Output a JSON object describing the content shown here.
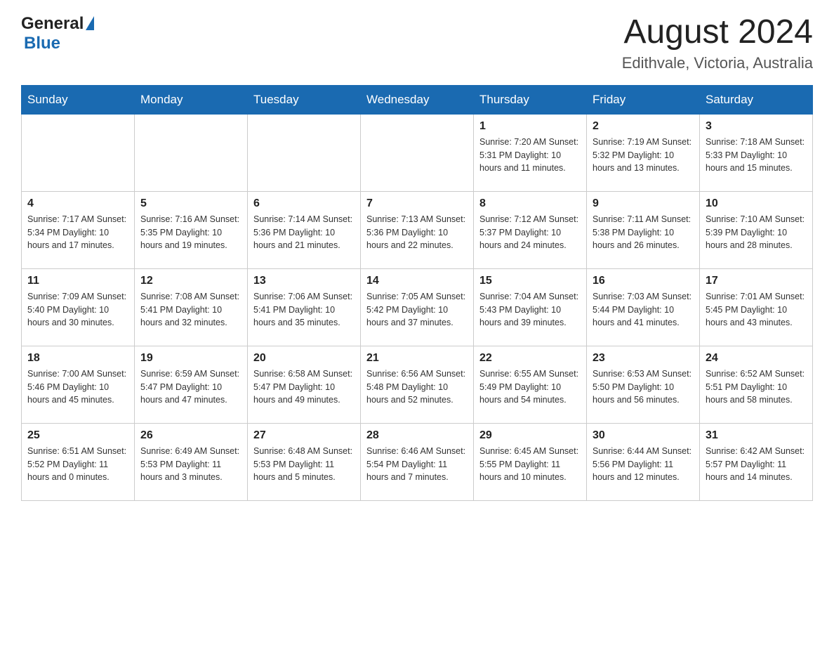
{
  "header": {
    "title": "August 2024",
    "subtitle": "Edithvale, Victoria, Australia"
  },
  "logo": {
    "text1": "General",
    "text2": "Blue"
  },
  "days_of_week": [
    "Sunday",
    "Monday",
    "Tuesday",
    "Wednesday",
    "Thursday",
    "Friday",
    "Saturday"
  ],
  "weeks": [
    [
      {
        "day": "",
        "info": ""
      },
      {
        "day": "",
        "info": ""
      },
      {
        "day": "",
        "info": ""
      },
      {
        "day": "",
        "info": ""
      },
      {
        "day": "1",
        "info": "Sunrise: 7:20 AM\nSunset: 5:31 PM\nDaylight: 10 hours\nand 11 minutes."
      },
      {
        "day": "2",
        "info": "Sunrise: 7:19 AM\nSunset: 5:32 PM\nDaylight: 10 hours\nand 13 minutes."
      },
      {
        "day": "3",
        "info": "Sunrise: 7:18 AM\nSunset: 5:33 PM\nDaylight: 10 hours\nand 15 minutes."
      }
    ],
    [
      {
        "day": "4",
        "info": "Sunrise: 7:17 AM\nSunset: 5:34 PM\nDaylight: 10 hours\nand 17 minutes."
      },
      {
        "day": "5",
        "info": "Sunrise: 7:16 AM\nSunset: 5:35 PM\nDaylight: 10 hours\nand 19 minutes."
      },
      {
        "day": "6",
        "info": "Sunrise: 7:14 AM\nSunset: 5:36 PM\nDaylight: 10 hours\nand 21 minutes."
      },
      {
        "day": "7",
        "info": "Sunrise: 7:13 AM\nSunset: 5:36 PM\nDaylight: 10 hours\nand 22 minutes."
      },
      {
        "day": "8",
        "info": "Sunrise: 7:12 AM\nSunset: 5:37 PM\nDaylight: 10 hours\nand 24 minutes."
      },
      {
        "day": "9",
        "info": "Sunrise: 7:11 AM\nSunset: 5:38 PM\nDaylight: 10 hours\nand 26 minutes."
      },
      {
        "day": "10",
        "info": "Sunrise: 7:10 AM\nSunset: 5:39 PM\nDaylight: 10 hours\nand 28 minutes."
      }
    ],
    [
      {
        "day": "11",
        "info": "Sunrise: 7:09 AM\nSunset: 5:40 PM\nDaylight: 10 hours\nand 30 minutes."
      },
      {
        "day": "12",
        "info": "Sunrise: 7:08 AM\nSunset: 5:41 PM\nDaylight: 10 hours\nand 32 minutes."
      },
      {
        "day": "13",
        "info": "Sunrise: 7:06 AM\nSunset: 5:41 PM\nDaylight: 10 hours\nand 35 minutes."
      },
      {
        "day": "14",
        "info": "Sunrise: 7:05 AM\nSunset: 5:42 PM\nDaylight: 10 hours\nand 37 minutes."
      },
      {
        "day": "15",
        "info": "Sunrise: 7:04 AM\nSunset: 5:43 PM\nDaylight: 10 hours\nand 39 minutes."
      },
      {
        "day": "16",
        "info": "Sunrise: 7:03 AM\nSunset: 5:44 PM\nDaylight: 10 hours\nand 41 minutes."
      },
      {
        "day": "17",
        "info": "Sunrise: 7:01 AM\nSunset: 5:45 PM\nDaylight: 10 hours\nand 43 minutes."
      }
    ],
    [
      {
        "day": "18",
        "info": "Sunrise: 7:00 AM\nSunset: 5:46 PM\nDaylight: 10 hours\nand 45 minutes."
      },
      {
        "day": "19",
        "info": "Sunrise: 6:59 AM\nSunset: 5:47 PM\nDaylight: 10 hours\nand 47 minutes."
      },
      {
        "day": "20",
        "info": "Sunrise: 6:58 AM\nSunset: 5:47 PM\nDaylight: 10 hours\nand 49 minutes."
      },
      {
        "day": "21",
        "info": "Sunrise: 6:56 AM\nSunset: 5:48 PM\nDaylight: 10 hours\nand 52 minutes."
      },
      {
        "day": "22",
        "info": "Sunrise: 6:55 AM\nSunset: 5:49 PM\nDaylight: 10 hours\nand 54 minutes."
      },
      {
        "day": "23",
        "info": "Sunrise: 6:53 AM\nSunset: 5:50 PM\nDaylight: 10 hours\nand 56 minutes."
      },
      {
        "day": "24",
        "info": "Sunrise: 6:52 AM\nSunset: 5:51 PM\nDaylight: 10 hours\nand 58 minutes."
      }
    ],
    [
      {
        "day": "25",
        "info": "Sunrise: 6:51 AM\nSunset: 5:52 PM\nDaylight: 11 hours\nand 0 minutes."
      },
      {
        "day": "26",
        "info": "Sunrise: 6:49 AM\nSunset: 5:53 PM\nDaylight: 11 hours\nand 3 minutes."
      },
      {
        "day": "27",
        "info": "Sunrise: 6:48 AM\nSunset: 5:53 PM\nDaylight: 11 hours\nand 5 minutes."
      },
      {
        "day": "28",
        "info": "Sunrise: 6:46 AM\nSunset: 5:54 PM\nDaylight: 11 hours\nand 7 minutes."
      },
      {
        "day": "29",
        "info": "Sunrise: 6:45 AM\nSunset: 5:55 PM\nDaylight: 11 hours\nand 10 minutes."
      },
      {
        "day": "30",
        "info": "Sunrise: 6:44 AM\nSunset: 5:56 PM\nDaylight: 11 hours\nand 12 minutes."
      },
      {
        "day": "31",
        "info": "Sunrise: 6:42 AM\nSunset: 5:57 PM\nDaylight: 11 hours\nand 14 minutes."
      }
    ]
  ]
}
